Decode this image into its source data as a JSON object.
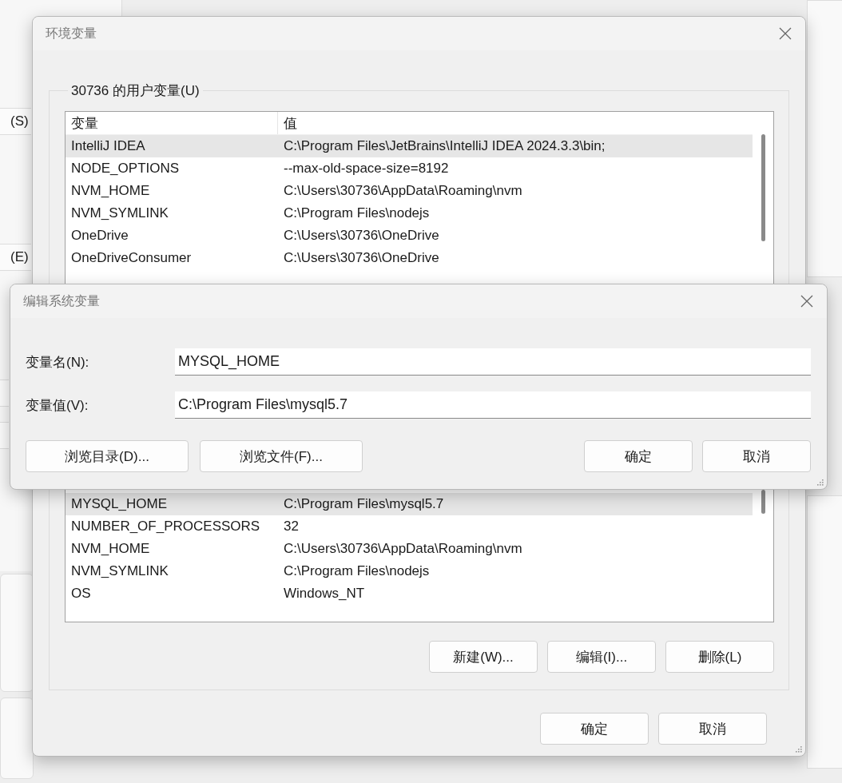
{
  "background_window": {
    "fragments": [
      "(S)",
      "(E)"
    ]
  },
  "env_window": {
    "title": "环境变量",
    "user_vars": {
      "label": "30736 的用户变量(U)",
      "columns": [
        "变量",
        "值"
      ],
      "rows": [
        {
          "name": "IntelliJ IDEA",
          "value": "C:\\Program Files\\JetBrains\\IntelliJ IDEA 2024.3.3\\bin;",
          "selected": true
        },
        {
          "name": "NODE_OPTIONS",
          "value": "--max-old-space-size=8192",
          "selected": false
        },
        {
          "name": "NVM_HOME",
          "value": "C:\\Users\\30736\\AppData\\Roaming\\nvm",
          "selected": false
        },
        {
          "name": "NVM_SYMLINK",
          "value": "C:\\Program Files\\nodejs",
          "selected": false
        },
        {
          "name": "OneDrive",
          "value": "C:\\Users\\30736\\OneDrive",
          "selected": false
        },
        {
          "name": "OneDriveConsumer",
          "value": "C:\\Users\\30736\\OneDrive",
          "selected": false
        }
      ]
    },
    "system_vars": {
      "rows": [
        {
          "name": "MYSQL_HOME",
          "value": "C:\\Program Files\\mysql5.7",
          "selected": true
        },
        {
          "name": "NUMBER_OF_PROCESSORS",
          "value": "32",
          "selected": false
        },
        {
          "name": "NVM_HOME",
          "value": "C:\\Users\\30736\\AppData\\Roaming\\nvm",
          "selected": false
        },
        {
          "name": "NVM_SYMLINK",
          "value": "C:\\Program Files\\nodejs",
          "selected": false
        },
        {
          "name": "OS",
          "value": "Windows_NT",
          "selected": false
        }
      ],
      "buttons": [
        "新建(W)...",
        "编辑(I)...",
        "删除(L)"
      ]
    },
    "buttons": [
      "确定",
      "取消"
    ]
  },
  "edit_dialog": {
    "title": "编辑系统变量",
    "fields": [
      {
        "label": "变量名(N):",
        "value": "MYSQL_HOME"
      },
      {
        "label": "变量值(V):",
        "value": "C:\\Program Files\\mysql5.7"
      }
    ],
    "left_buttons": [
      "浏览目录(D)...",
      "浏览文件(F)..."
    ],
    "right_buttons": [
      "确定",
      "取消"
    ]
  }
}
